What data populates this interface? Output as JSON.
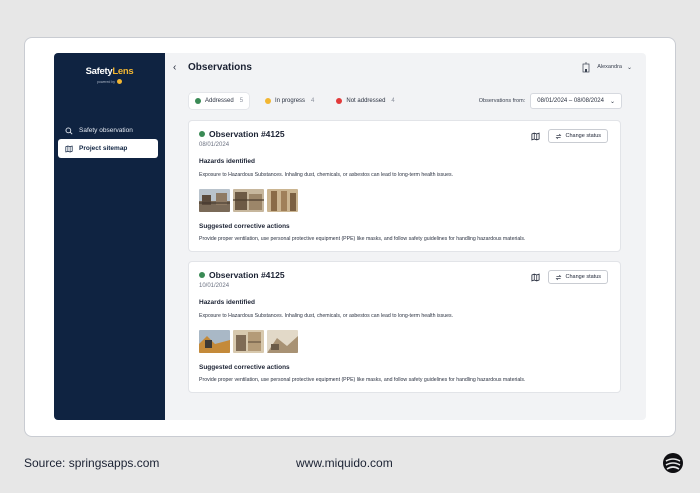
{
  "brand": {
    "name_part1": "Safety",
    "name_part2": "Lens",
    "tagline": "powered by"
  },
  "sidebar": {
    "items": [
      {
        "label": "Safety observation",
        "icon": "search-icon",
        "active": false
      },
      {
        "label": "Project sitemap",
        "icon": "map-icon",
        "active": true
      }
    ]
  },
  "header": {
    "back_icon": "chevron-left-icon",
    "title": "Observations",
    "user_name": "Alexandra"
  },
  "filters": [
    {
      "label": "Addressed",
      "count": "5",
      "color": "#3a8a55"
    },
    {
      "label": "In progress",
      "count": "4",
      "color": "#f2b632"
    },
    {
      "label": "Not addressed",
      "count": "4",
      "color": "#e23a3a"
    }
  ],
  "date_filter": {
    "label": "Observations from:",
    "range": "08/01/2024 – 08/08/2024"
  },
  "observations": [
    {
      "title": "Observation #4125",
      "date": "08/01/2024",
      "status_color": "#3a8a55",
      "change_status": "Change status",
      "hazards_title": "Hazards identified",
      "hazards_text": "Exposure to Hazardous Substances. Inhaling dust, chemicals, or asbestos can lead to long-term health issues.",
      "actions_title": "Suggested corrective actions",
      "actions_text": "Provide proper ventilation, use personal protective equipment (PPE) like masks, and follow safety guidelines for handling hazardous materials."
    },
    {
      "title": "Observation #4125",
      "date": "10/01/2024",
      "status_color": "#3a8a55",
      "change_status": "Change status",
      "hazards_title": "Hazards identified",
      "hazards_text": "Exposure to Hazardous Substances. Inhaling dust, chemicals, or asbestos can lead to long-term health issues.",
      "actions_title": "Suggested corrective actions",
      "actions_text": "Provide proper ventilation, use personal protective equipment (PPE) like masks, and follow safety guidelines for handling hazardous materials."
    }
  ],
  "footer": {
    "source": "Source: springsapps.com",
    "url": "www.miquido.com"
  },
  "colors": {
    "sidebar_bg": "#0f2341",
    "accent": "#f2b632",
    "page_bg": "#f2f3f5"
  }
}
